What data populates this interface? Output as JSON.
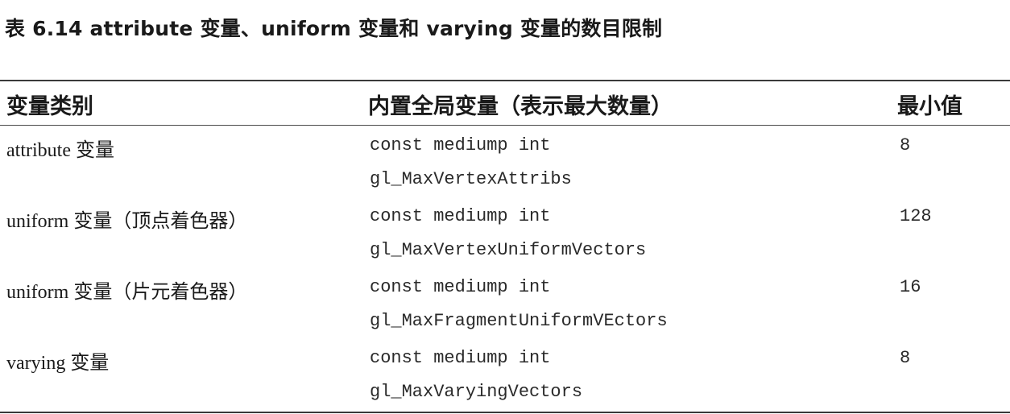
{
  "caption": "表 6.14  attribute 变量、uniform 变量和 varying 变量的数目限制",
  "table": {
    "headers": [
      "变量类别",
      "内置全局变量（表示最大数量）",
      "最小值"
    ],
    "rows": [
      {
        "category": "attribute 变量",
        "code_line1": "const mediump int",
        "code_line2": "gl_MaxVertexAttribs",
        "min": "8"
      },
      {
        "category": "uniform 变量（顶点着色器）",
        "code_line1": "const mediump int",
        "code_line2": "gl_MaxVertexUniformVectors",
        "min": "128"
      },
      {
        "category": "uniform 变量（片元着色器）",
        "code_line1": "const mediump int",
        "code_line2": "gl_MaxFragmentUniformVEctors",
        "min": "16"
      },
      {
        "category": "varying 变量",
        "code_line1": "const mediump int",
        "code_line2": "gl_MaxVaryingVectors",
        "min": "8"
      }
    ]
  }
}
